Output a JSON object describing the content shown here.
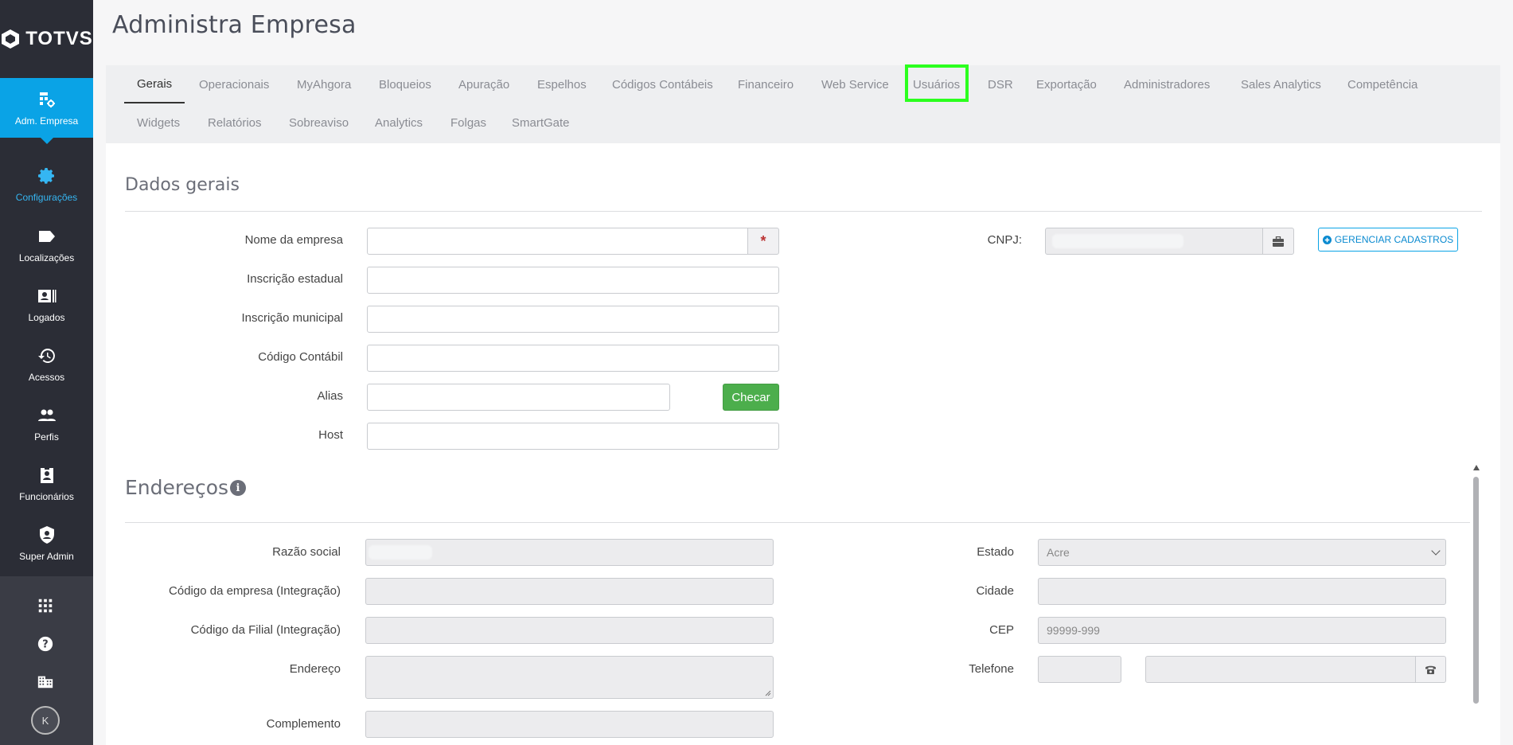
{
  "brand": {
    "name": "TOTVS"
  },
  "sidebar": {
    "items": [
      {
        "label": "Adm. Empresa",
        "icon": "building-settings-icon"
      },
      {
        "label": "Configurações",
        "icon": "gear-icon"
      },
      {
        "label": "Localizações",
        "icon": "tag-icon"
      },
      {
        "label": "Logados",
        "icon": "id-card-icon"
      },
      {
        "label": "Acessos",
        "icon": "history-icon"
      },
      {
        "label": "Perfis",
        "icon": "users-icon"
      },
      {
        "label": "Funcionários",
        "icon": "badge-icon"
      },
      {
        "label": "Super Admin",
        "icon": "shield-user-icon"
      }
    ],
    "bottom_icons": [
      "apps-grid-icon",
      "help-icon",
      "company-icon"
    ],
    "avatar_initial": "K"
  },
  "header": {
    "title": "Administra Empresa"
  },
  "tabs": {
    "row1": [
      "Gerais",
      "Operacionais",
      "MyAhgora",
      "Bloqueios",
      "Apuração",
      "Espelhos",
      "Códigos Contábeis",
      "Financeiro",
      "Web Service",
      "Usuários",
      "DSR",
      "Exportação",
      "Administradores",
      "Sales Analytics",
      "Competência"
    ],
    "row2": [
      "Widgets",
      "Relatórios",
      "Sobreaviso",
      "Analytics",
      "Folgas",
      "SmartGate"
    ],
    "active": "Gerais"
  },
  "dados_gerais": {
    "title": "Dados gerais",
    "labels": {
      "nome": "Nome da empresa",
      "inscricao_estadual": "Inscrição estadual",
      "inscricao_municipal": "Inscrição municipal",
      "codigo_contabil": "Código Contábil",
      "alias": "Alias",
      "host": "Host",
      "cnpj": "CNPJ:"
    },
    "required_mark": "*",
    "checar_button": "Checar",
    "gerenciar_button": "GERENCIAR CADASTROS"
  },
  "enderecos": {
    "title": "Endereços",
    "labels": {
      "razao_social": "Razão social",
      "codigo_empresa": "Código da empresa (Integração)",
      "codigo_filial": "Código da Filial (Integração)",
      "endereco": "Endereço",
      "complemento": "Complemento",
      "estado": "Estado",
      "cidade": "Cidade",
      "cep": "CEP",
      "telefone": "Telefone"
    },
    "estado_value": "Acre",
    "cep_placeholder": "99999-999"
  },
  "colors": {
    "accent": "#0aa3e6",
    "sidebar": "#2b2d36",
    "highlight": "#2bff1e",
    "success": "#4cae4c"
  }
}
